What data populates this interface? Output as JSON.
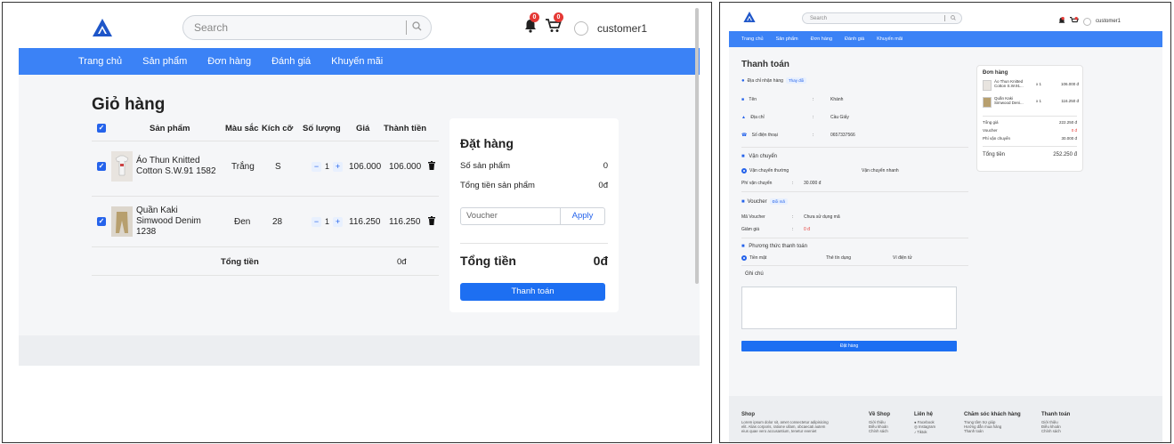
{
  "left": {
    "header": {
      "search_placeholder": "Search",
      "bell_count": "0",
      "cart_count": "0",
      "username": "customer1"
    },
    "nav": [
      "Trang chủ",
      "Sản phẩm",
      "Đơn hàng",
      "Đánh giá",
      "Khuyến mãi"
    ],
    "cart": {
      "title": "Giỏ hàng",
      "columns": [
        "Sản phẩm",
        "Màu sắc",
        "Kích cỡ",
        "Số lượng",
        "Giá",
        "Thành tiền"
      ],
      "items": [
        {
          "name": "Áo Thun Knitted Cotton S.W.91 1582",
          "color": "Trắng",
          "size": "S",
          "qty": "1",
          "price": "106.000",
          "total": "106.000"
        },
        {
          "name": "Quần Kaki Simwood Denim 1238",
          "color": "Đen",
          "size": "28",
          "qty": "1",
          "price": "116.250",
          "total": "116.250"
        }
      ],
      "total_label": "Tổng tiền",
      "total_value": "0đ",
      "minus": "−",
      "plus": "+"
    },
    "order": {
      "title": "Đặt hàng",
      "count_label": "Số sản phẩm",
      "count_value": "0",
      "subtotal_label": "Tổng tiền sản phẩm",
      "subtotal_value": "0đ",
      "voucher_placeholder": "Voucher",
      "apply_label": "Apply",
      "total_label": "Tổng tiền",
      "total_value": "0đ",
      "checkout_label": "Thanh toán"
    }
  },
  "right": {
    "header": {
      "search_placeholder": "Search",
      "username": "customer1"
    },
    "nav": [
      "Trang chủ",
      "Sản phẩm",
      "Đơn hàng",
      "Đánh giá",
      "Khuyến mãi"
    ],
    "checkout": {
      "title": "Thanh toán",
      "address_label": "Địa chỉ nhận hàng",
      "change_label": "Thay đổi",
      "fields": [
        {
          "label": "Tên",
          "value": "Khánh"
        },
        {
          "label": "Địa chỉ",
          "value": "Cầu Giấy"
        },
        {
          "label": "Số điện thoại",
          "value": "0657337566"
        }
      ],
      "shipping_title": "Vận chuyển",
      "shipping_normal": "Vận chuyển thường",
      "shipping_fast": "Vận chuyển nhanh",
      "shipping_fee_label": "Phí vận chuyển",
      "shipping_fee_value": "30.000 đ",
      "voucher_title": "Voucher",
      "voucher_change": "Đổi mã",
      "voucher_code_label": "Mã Voucher",
      "voucher_code_value": "Chưa sử dụng mã",
      "discount_label": "Giảm giá",
      "discount_value": "0 đ",
      "payment_title": "Phương thức thanh toán",
      "payment_options": [
        "Tiền mặt",
        "Thẻ tín dụng",
        "Ví điện tử"
      ],
      "note_label": "Ghi chú",
      "submit_label": "Đặt hàng"
    },
    "summary": {
      "title": "Đơn hàng",
      "items": [
        {
          "name1": "Áo Thun Knitted",
          "name2": "Cotton S.W.91...",
          "qty": "x 1",
          "price": "106.000 đ"
        },
        {
          "name1": "Quần Kaki",
          "name2": "Simwood Deni...",
          "qty": "x 1",
          "price": "116.250 đ"
        }
      ],
      "rows": [
        {
          "label": "Tổng giá",
          "value": "222.250 đ"
        },
        {
          "label": "Voucher",
          "value": "0 đ"
        },
        {
          "label": "Phí vận chuyển",
          "value": "30.000 đ"
        }
      ],
      "total_label": "Tổng tiền",
      "total_value": "252.250 đ"
    },
    "footer": {
      "columns": [
        {
          "title": "Shop",
          "lines": [
            "Lorem ipsum dolor sit, amet consectetur adipisicing",
            "elit. Alias corporis, ratione ullam, obcaecati autem",
            "eius quae vero accusantium, tenetur eveniet"
          ]
        },
        {
          "title": "Về Shop",
          "lines": [
            "Giới thiệu",
            "Điều khoản",
            "Chính sách"
          ]
        },
        {
          "title": "Liên hệ",
          "lines": [
            "Facebook",
            "Instagram",
            "Tiktok"
          ]
        },
        {
          "title": "Chăm sóc khách hàng",
          "lines": [
            "Trung tâm trợ giúp",
            "Hướng dẫn mua hàng",
            "Thanh toán"
          ]
        },
        {
          "title": "Thanh toán",
          "lines": [
            "Giới thiệu",
            "Điều khoản",
            "Chính sách"
          ]
        }
      ]
    }
  }
}
